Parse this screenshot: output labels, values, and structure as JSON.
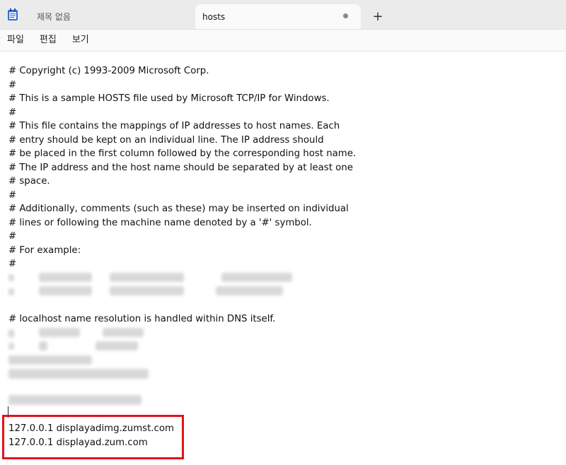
{
  "tabs": [
    {
      "label": "제목 없음",
      "active": false
    },
    {
      "label": "hosts",
      "active": true,
      "modified": true
    }
  ],
  "new_tab_symbol": "+",
  "menu": [
    "파일",
    "편집",
    "보기"
  ],
  "content_lines": [
    "# Copyright (c) 1993-2009 Microsoft Corp.",
    "#",
    "# This is a sample HOSTS file used by Microsoft TCP/IP for Windows.",
    "#",
    "# This file contains the mappings of IP addresses to host names. Each",
    "# entry should be kept on an individual line. The IP address should",
    "# be placed in the first column followed by the corresponding host name.",
    "# The IP address and the host name should be separated by at least one",
    "# space.",
    "#",
    "# Additionally, comments (such as these) may be inserted on individual",
    "# lines or following the machine name denoted by a '#' symbol.",
    "#",
    "# For example:",
    "#",
    "# localhost name resolution is handled within DNS itself.",
    "127.0.0.1 displayadimg.zumst.com",
    "127.0.0.1 displayad.zum.com"
  ],
  "highlight_color": "#e0141a"
}
